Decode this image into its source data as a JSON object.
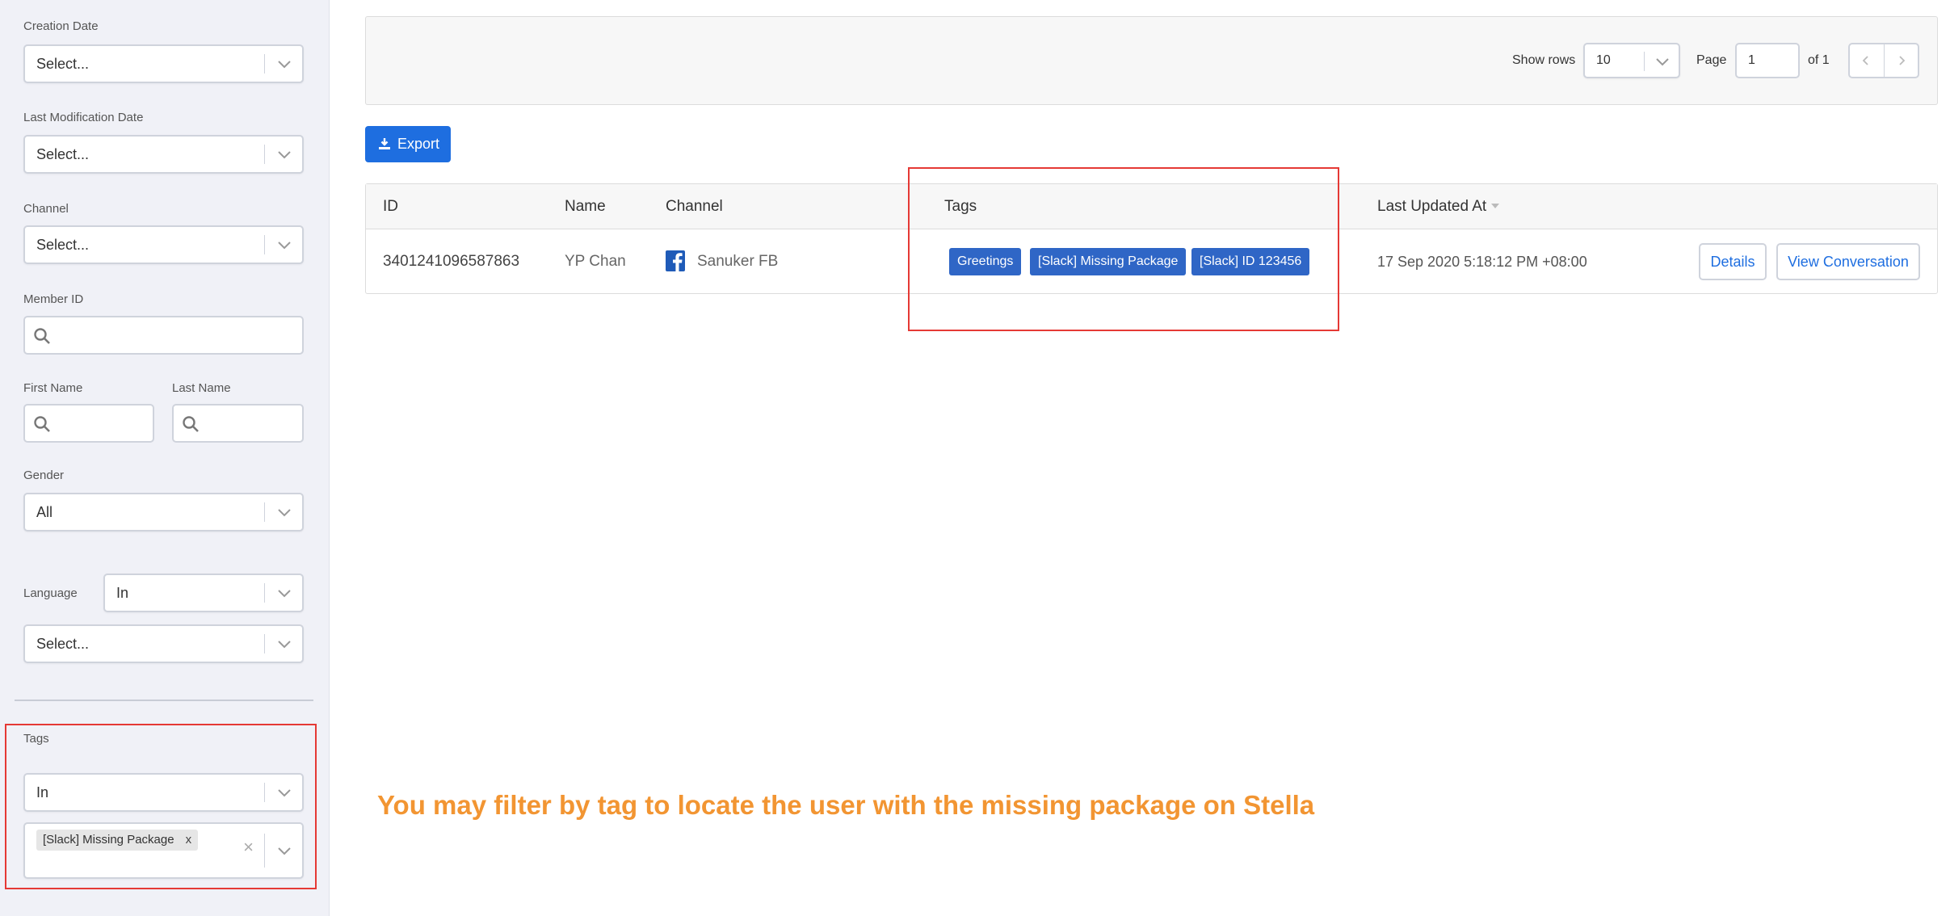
{
  "sidebar": {
    "creation_date": {
      "label": "Creation Date",
      "value": "Select..."
    },
    "last_modification_date": {
      "label": "Last Modification Date",
      "value": "Select..."
    },
    "channel": {
      "label": "Channel",
      "value": "Select..."
    },
    "member_id": {
      "label": "Member ID"
    },
    "first_name": {
      "label": "First Name"
    },
    "last_name": {
      "label": "Last Name"
    },
    "gender": {
      "label": "Gender",
      "value": "All"
    },
    "language": {
      "label": "Language",
      "operator": "In",
      "value": "Select..."
    },
    "tags": {
      "label": "Tags",
      "operator": "In",
      "selected_chip": "[Slack] Missing Package",
      "chip_remove": "x"
    }
  },
  "toolbar": {
    "show_rows_label": "Show rows",
    "rows_value": "10",
    "page_label": "Page",
    "page_value": "1",
    "of_label": "of 1",
    "export_label": "Export"
  },
  "table": {
    "headers": {
      "id": "ID",
      "name": "Name",
      "channel": "Channel",
      "tags": "Tags",
      "last_updated": "Last Updated At"
    },
    "rows": [
      {
        "id": "3401241096587863",
        "name": "YP Chan",
        "channel_icon": "facebook-icon",
        "channel": "Sanuker FB",
        "tags": [
          "Greetings",
          "[Slack] Missing Package",
          "[Slack] ID 123456"
        ],
        "last_updated": "17 Sep 2020 5:18:12 PM +08:00",
        "details_label": "Details",
        "view_conversation_label": "View Conversation"
      }
    ]
  },
  "annotation": {
    "text": "You may filter by tag to locate the user with the missing package on Stella",
    "color": "#f29532",
    "highlight_color": "#e53935"
  },
  "colors": {
    "primary": "#1e6ee0",
    "tag": "#2f66c6",
    "sidebar_bg": "#f0f1f7"
  }
}
